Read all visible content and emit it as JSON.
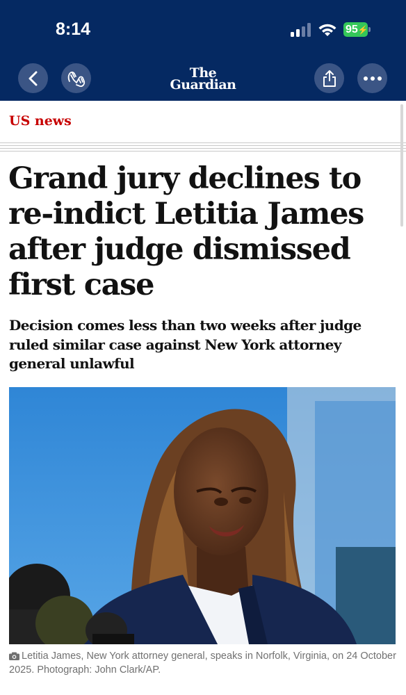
{
  "status_bar": {
    "time": "8:14",
    "battery": "95"
  },
  "toolbar": {
    "back_icon": "chevron-left-icon",
    "sources_icon": "hands-icon",
    "logo_line1": "The",
    "logo_line2": "Guardian",
    "share_icon": "share-icon",
    "more_icon": "ellipsis-icon"
  },
  "article": {
    "section": "US news",
    "headline": "Grand jury declines to re-indict Letitia James after judge dismissed first case",
    "standfirst": "Decision comes less than two weeks after judge ruled similar case against New York attorney general unlawful",
    "caption": "Letitia James, New York attorney general, speaks in Norfolk, Virginia, on 24 October 2025. Photograph: John Clark/AP."
  },
  "colors": {
    "topbar": "#052962",
    "section": "#c70000",
    "battery": "#34c759",
    "sky": "#3e8fd8",
    "jacket": "#16264f"
  }
}
